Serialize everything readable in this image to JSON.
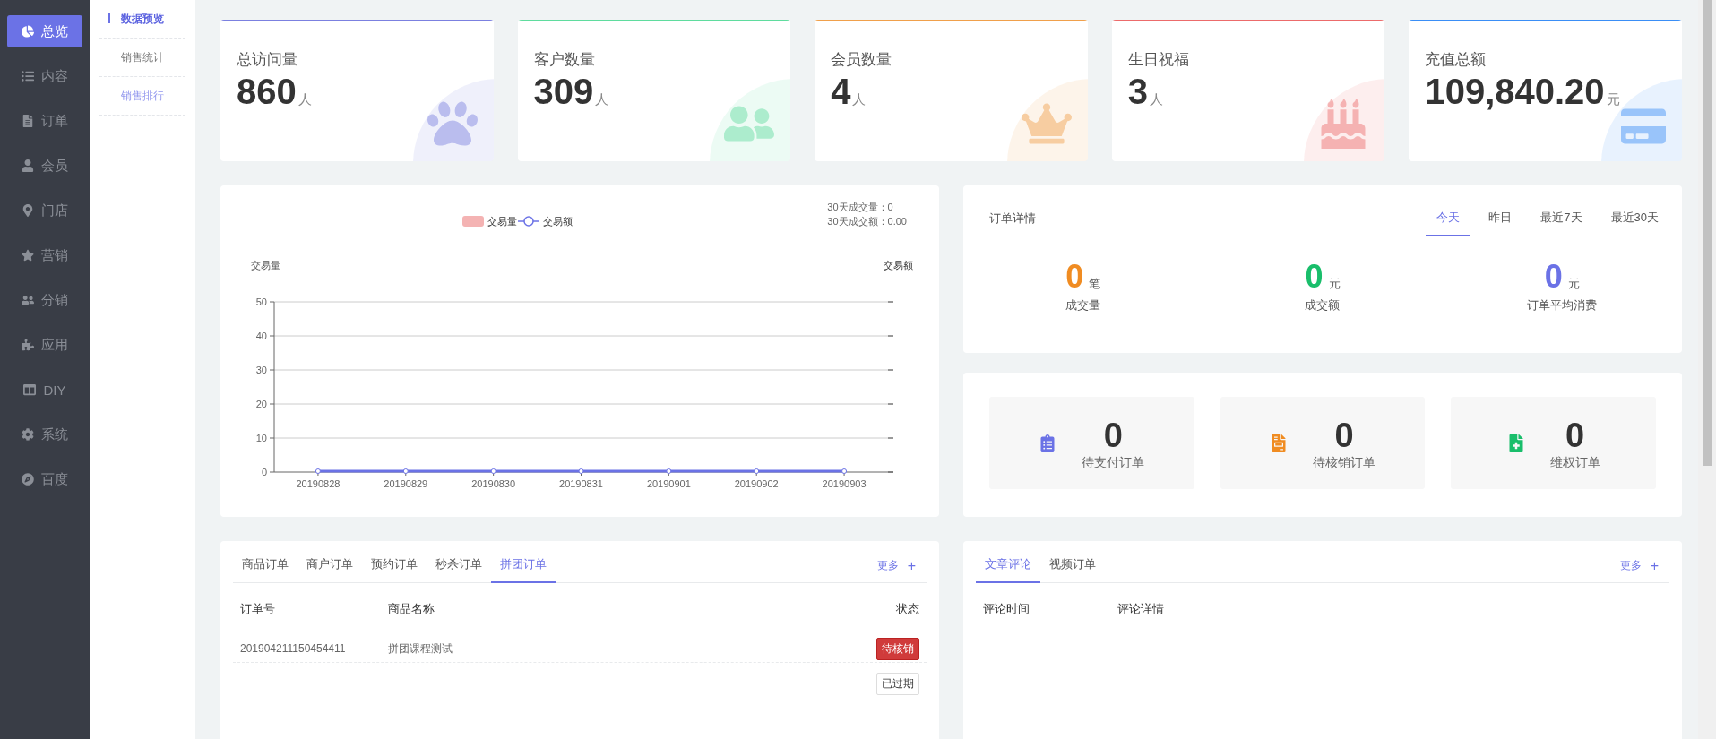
{
  "sidebar": {
    "items": [
      {
        "label": "总览",
        "selected": true
      },
      {
        "label": "内容",
        "selected": false
      },
      {
        "label": "订单",
        "selected": false
      },
      {
        "label": "会员",
        "selected": false
      },
      {
        "label": "门店",
        "selected": false
      },
      {
        "label": "营销",
        "selected": false
      },
      {
        "label": "分销",
        "selected": false
      },
      {
        "label": "应用",
        "selected": false
      },
      {
        "label": "DIY",
        "selected": false
      },
      {
        "label": "系统",
        "selected": false
      },
      {
        "label": "百度",
        "selected": false
      }
    ]
  },
  "submenu": {
    "items": [
      {
        "label": "数据预览",
        "selected": true,
        "hovered": false
      },
      {
        "label": "销售统计",
        "selected": false,
        "hovered": false
      },
      {
        "label": "销售排行",
        "selected": false,
        "hovered": true
      }
    ]
  },
  "stat_cards": [
    {
      "title": "总访问量",
      "value": "860",
      "unit": "人",
      "color": "#7b80e0"
    },
    {
      "title": "客户数量",
      "value": "309",
      "unit": "人",
      "color": "#5fdc9e"
    },
    {
      "title": "会员数量",
      "value": "4",
      "unit": "人",
      "color": "#f0a04b"
    },
    {
      "title": "生日祝福",
      "value": "3",
      "unit": "人",
      "color": "#ec6b6b"
    },
    {
      "title": "充值总额",
      "value": "109,840.20",
      "unit": "元",
      "color": "#3a8ef6"
    }
  ],
  "trade_chart": {
    "summary": [
      "30天成交量：0",
      "30天成交额：0.00"
    ],
    "chart_data": {
      "type": "bar",
      "ylabel": "交易量",
      "y2label": "交易额",
      "categories": [
        "20190828",
        "20190829",
        "20190830",
        "20190831",
        "20190901",
        "20190902",
        "20190903"
      ],
      "ylim": [
        0,
        50
      ],
      "grid": true,
      "yticks": [
        0,
        10,
        20,
        30,
        40,
        50
      ],
      "series": [
        {
          "name": "交易量",
          "type": "bar",
          "color": "#f4b3b3",
          "values": [
            0,
            0,
            0,
            0,
            0,
            0,
            0
          ]
        },
        {
          "name": "交易额",
          "type": "line",
          "marker": "circle",
          "color": "#6b72e6",
          "values": [
            0,
            0,
            0,
            0,
            0,
            0,
            0
          ]
        }
      ]
    }
  },
  "order_detail": {
    "title": "订单详情",
    "tabs": [
      {
        "label": "今天",
        "selected": true
      },
      {
        "label": "昨日",
        "selected": false
      },
      {
        "label": "最近7天",
        "selected": false
      },
      {
        "label": "最近30天",
        "selected": false
      }
    ],
    "stats": [
      {
        "value": "0",
        "unit": "笔",
        "label": "成交量",
        "color": "#f08c22"
      },
      {
        "value": "0",
        "unit": "元",
        "label": "成交额",
        "color": "#19be6b"
      },
      {
        "value": "0",
        "unit": "元",
        "label": "订单平均消费",
        "color": "#6b72e6"
      }
    ]
  },
  "pending": [
    {
      "value": "0",
      "label": "待支付订单",
      "color": "#6b72e6"
    },
    {
      "value": "0",
      "label": "待核销订单",
      "color": "#f08c22"
    },
    {
      "value": "0",
      "label": "维权订单",
      "color": "#19be6b"
    }
  ],
  "orders_panel": {
    "tabs": [
      {
        "label": "商品订单",
        "selected": false
      },
      {
        "label": "商户订单",
        "selected": false
      },
      {
        "label": "预约订单",
        "selected": false
      },
      {
        "label": "秒杀订单",
        "selected": false
      },
      {
        "label": "拼团订单",
        "selected": true
      }
    ],
    "more": "更多",
    "add": "+",
    "columns": [
      "订单号",
      "商品名称",
      "状态"
    ],
    "rows": [
      {
        "order_no": "201904211150454411",
        "product": "拼团课程测试",
        "status": {
          "label": "待核销",
          "kind": "danger"
        }
      },
      {
        "status": {
          "label": "已过期",
          "kind": "plain"
        }
      }
    ]
  },
  "comments_panel": {
    "tabs": [
      {
        "label": "文章评论",
        "selected": true
      },
      {
        "label": "视频订单",
        "selected": false
      }
    ],
    "more": "更多",
    "add": "+",
    "columns": [
      "评论时间",
      "评论详情"
    ]
  }
}
